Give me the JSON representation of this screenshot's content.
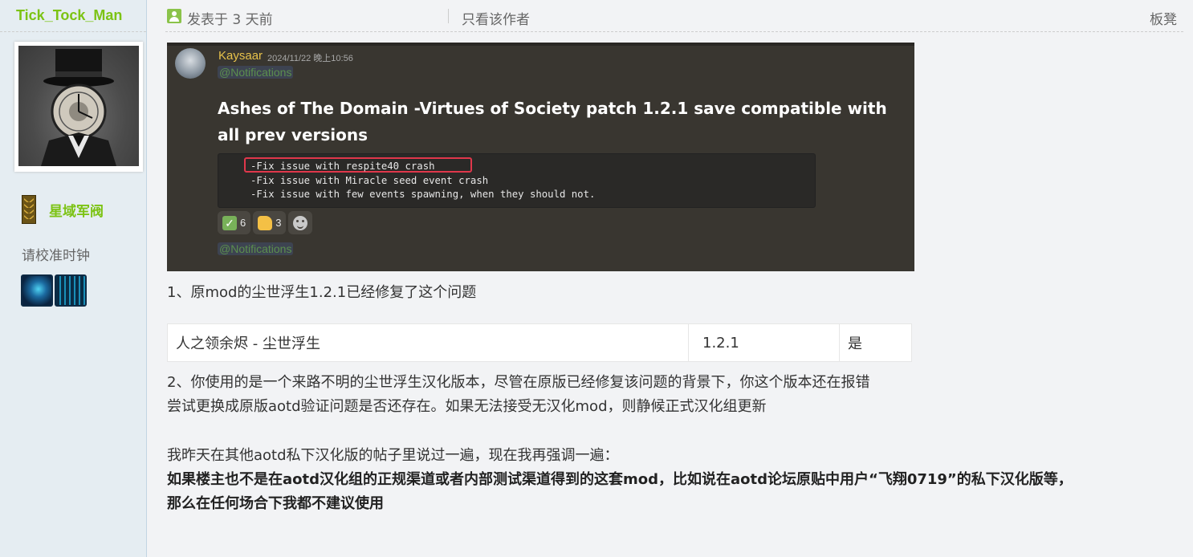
{
  "user": {
    "name": "Tick_Tock_Man",
    "rank": "星域军阀",
    "status": "请校准时钟"
  },
  "post_header": {
    "posted": "发表于 3 天前",
    "author_only": "只看该作者",
    "floor": "板凳"
  },
  "embed": {
    "username": "Kaysaar",
    "date": "2024/11/22 晚上10:56",
    "mention_top": "@Notifications",
    "title": "Ashes of The Domain -Virtues of Society  patch 1.2.1  save compatible with  all prev versions",
    "code_lines": [
      "-Fix issue with respite40 crash",
      "-Fix issue with Miracle seed event crash",
      "-Fix issue with few events spawning, when they should not."
    ],
    "reactions": [
      {
        "emoji": "white-check-mark",
        "count": "6"
      },
      {
        "emoji": "thumbs-up",
        "count": "3"
      },
      {
        "emoji": "add-reaction",
        "count": ""
      }
    ],
    "mention_bottom": "@Notifications"
  },
  "body": {
    "line1": "1、原mod的尘世浮生1.2.1已经修复了这个问题",
    "table": [
      [
        "人之领余烬 - 尘世浮生",
        "1.2.1",
        "是"
      ]
    ],
    "line2": "2、你使用的是一个来路不明的尘世浮生汉化版本，尽管在原版已经修复该问题的背景下，你这个版本还在报错",
    "line3": "尝试更换成原版aotd验证问题是否还存在。如果无法接受无汉化mod，则静候正式汉化组更新",
    "line4": "我昨天在其他aotd私下汉化版的帖子里说过一遍，现在我再强调一遍：",
    "bold1": "如果楼主也不是在aotd汉化组的正规渠道或者内部测试渠道得到的这套mod，比如说在aotd论坛原贴中用户“飞翔0719”的私下汉化版等，",
    "bold2": "那么在任何场合下我都不建议使用"
  },
  "colors": {
    "username": "#7cc314",
    "highlight_box": "#e0374b",
    "embed_bg": "#393630"
  }
}
